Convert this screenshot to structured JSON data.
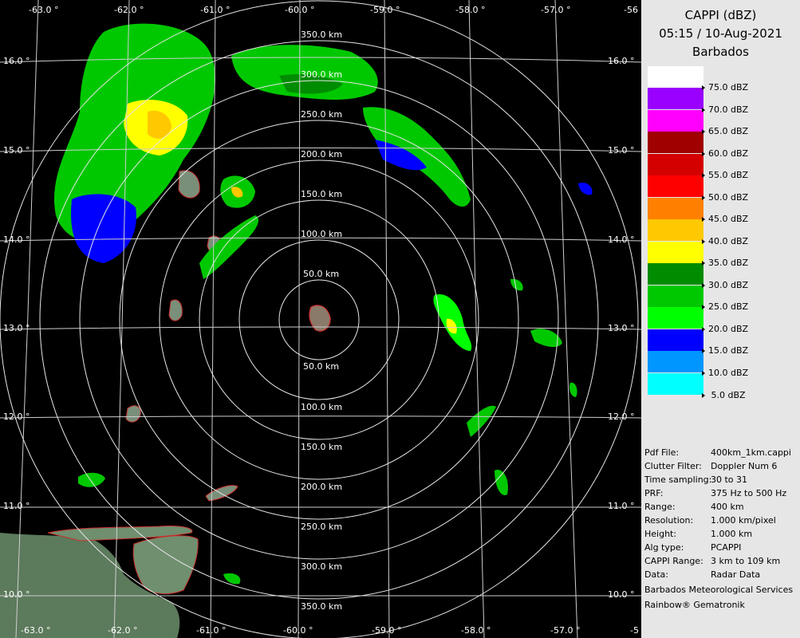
{
  "panel": {
    "title": "CAPPI (dBZ)",
    "datetime": "05:15 / 10-Aug-2021",
    "location": "Barbados"
  },
  "legend": [
    {
      "label": "75.0 dBZ",
      "color": "#ffffff"
    },
    {
      "label": "70.0 dBZ",
      "color": "#9a00ff"
    },
    {
      "label": "65.0 dBZ",
      "color": "#ff00ff"
    },
    {
      "label": "60.0 dBZ",
      "color": "#a00000"
    },
    {
      "label": "55.0 dBZ",
      "color": "#d40000"
    },
    {
      "label": "50.0 dBZ",
      "color": "#ff0000"
    },
    {
      "label": "45.0 dBZ",
      "color": "#ff8000"
    },
    {
      "label": "40.0 dBZ",
      "color": "#ffc800"
    },
    {
      "label": "35.0 dBZ",
      "color": "#ffff00"
    },
    {
      "label": "30.0 dBZ",
      "color": "#008c00"
    },
    {
      "label": "25.0 dBZ",
      "color": "#00c800"
    },
    {
      "label": "20.0 dBZ",
      "color": "#00ff00"
    },
    {
      "label": "15.0 dBZ",
      "color": "#0000ff"
    },
    {
      "label": "10.0 dBZ",
      "color": "#0096ff"
    },
    {
      "label": "5.0 dBZ",
      "color": "#00ffff"
    }
  ],
  "info": [
    {
      "key": "Pdf File:",
      "value": "400km_1km.cappi"
    },
    {
      "key": "Clutter Filter:",
      "value": "Doppler Num 6"
    },
    {
      "key": "Time sampling:",
      "value": "30 to 31"
    },
    {
      "key": "PRF:",
      "value": "375 Hz to 500 Hz"
    },
    {
      "key": "Range:",
      "value": "400 km"
    },
    {
      "key": "Resolution:",
      "value": "1.000 km/pixel"
    },
    {
      "key": "Height:",
      "value": "1.000 km"
    },
    {
      "key": "Alg type:",
      "value": "PCAPPI"
    },
    {
      "key": "CAPPI Range:",
      "value": "3 km to 109 km"
    },
    {
      "key": "Data:",
      "value": "Radar Data"
    }
  ],
  "credits": [
    "Barbados Meteorological Services",
    "Rainbow® Gematronik"
  ],
  "map": {
    "lon_labels_top": [
      "-63.0 °",
      "-62.0 °",
      "-61.0 °",
      "-60.0 °",
      "-59.0 °",
      "-58.0 °",
      "-57.0 °",
      "-56"
    ],
    "lon_labels_bottom": [
      "-63.0 °",
      "-62.0 °",
      "-61.0 °",
      "-60.0 °",
      "-59.0 °",
      "-58.0 °",
      "-57.0 °",
      "-5"
    ],
    "lat_labels_left": [
      "16.0 °",
      "15.0 °",
      "14.0 °",
      "13.0 °",
      "12.0 °",
      "11.0 °",
      "10.0 °"
    ],
    "lat_labels_right": [
      "16.0 °",
      "15.0 °",
      "14.0 °",
      "13.0 °",
      "12.0 °",
      "11.0 °",
      "10.0 °"
    ],
    "range_labels_north": [
      "50.0 km",
      "100.0 km",
      "150.0 km",
      "200.0 km",
      "250.0 km",
      "300.0 km",
      "350.0 km"
    ],
    "range_labels_south": [
      "50.0 km",
      "100.0 km",
      "150.0 km",
      "200.0 km",
      "250.0 km",
      "300.0 km",
      "350.0 km"
    ]
  }
}
